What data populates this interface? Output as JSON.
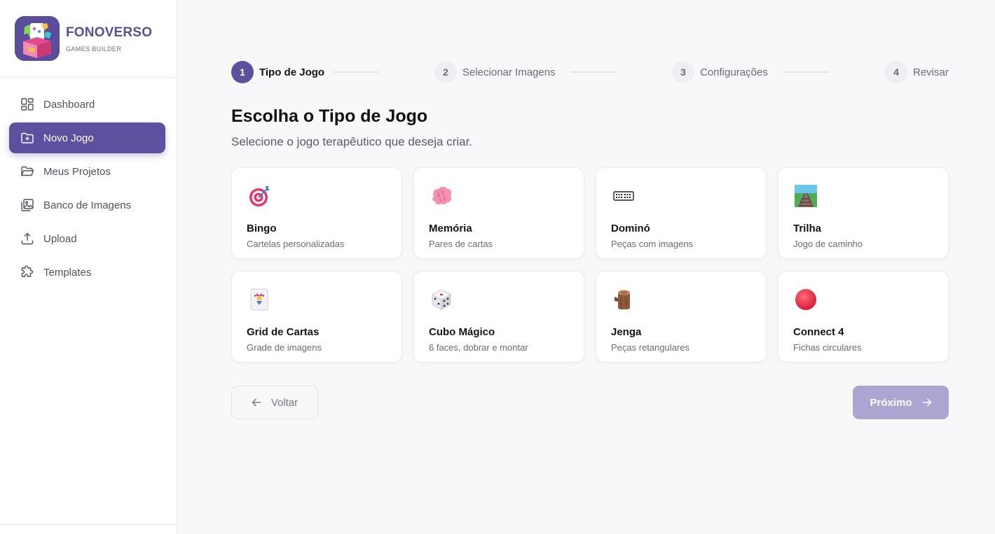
{
  "brand": {
    "title": "FONOVERSO",
    "subtitle": "GAMES BUILDER"
  },
  "sidebar": {
    "items": [
      {
        "label": "Dashboard",
        "icon": "dashboard-grid-icon",
        "active": false
      },
      {
        "label": "Novo Jogo",
        "icon": "folder-plus-icon",
        "active": true
      },
      {
        "label": "Meus Projetos",
        "icon": "folder-open-icon",
        "active": false
      },
      {
        "label": "Banco de Imagens",
        "icon": "images-icon",
        "active": false
      },
      {
        "label": "Upload",
        "icon": "upload-icon",
        "active": false
      },
      {
        "label": "Templates",
        "icon": "puzzle-icon",
        "active": false
      }
    ]
  },
  "stepper": {
    "steps": [
      {
        "number": "1",
        "label": "Tipo de Jogo",
        "active": true
      },
      {
        "number": "2",
        "label": "Selecionar Imagens",
        "active": false
      },
      {
        "number": "3",
        "label": "Configurações",
        "active": false
      },
      {
        "number": "4",
        "label": "Revisar",
        "active": false
      }
    ]
  },
  "page": {
    "title": "Escolha o Tipo de Jogo",
    "subtitle": "Selecione o jogo terapêutico que deseja criar."
  },
  "games": [
    {
      "title": "Bingo",
      "desc": "Cartelas personalizadas",
      "icon": "target-dart-icon"
    },
    {
      "title": "Memória",
      "desc": "Pares de cartas",
      "icon": "brain-icon"
    },
    {
      "title": "Dominó",
      "desc": "Peças com imagens",
      "icon": "domino-icon"
    },
    {
      "title": "Trilha",
      "desc": "Jogo de caminho",
      "icon": "railway-track-icon"
    },
    {
      "title": "Grid de Cartas",
      "desc": "Grade de imagens",
      "icon": "joker-card-icon"
    },
    {
      "title": "Cubo Mágico",
      "desc": "6 faces, dobrar e montar",
      "icon": "dice-icon"
    },
    {
      "title": "Jenga",
      "desc": "Peças retangulares",
      "icon": "wood-log-icon"
    },
    {
      "title": "Connect 4",
      "desc": "Fichas circulares",
      "icon": "red-circle-icon"
    }
  ],
  "actions": {
    "back_label": "Voltar",
    "next_label": "Próximo"
  },
  "colors": {
    "accent": "#5f509f",
    "next_disabled": "#aba5d1",
    "background": "#f8f8fa"
  }
}
